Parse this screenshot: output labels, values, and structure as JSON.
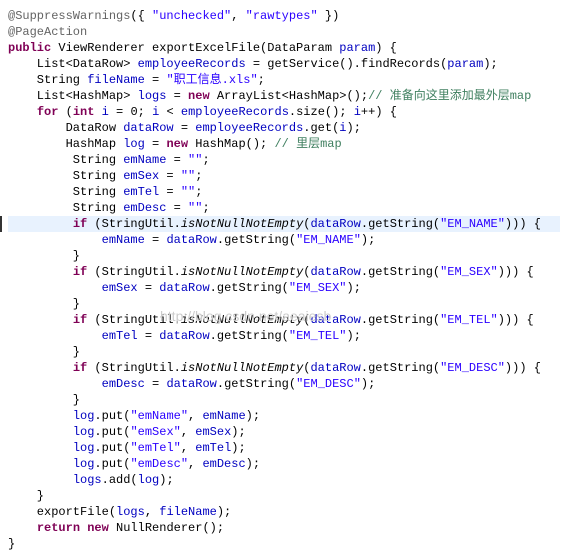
{
  "code": {
    "l1": {
      "ann": "@SuppressWarnings",
      "rest": "({ ",
      "s1": "\"unchecked\"",
      "mid": ", ",
      "s2": "\"rawtypes\"",
      "end": " })"
    },
    "l2": {
      "ann": "@PageAction"
    },
    "l3": {
      "kw": "public",
      "a": " ViewRenderer exportExcelFile(DataParam ",
      "p": "param",
      "b": ") {"
    },
    "l4": {
      "a": "    List<DataRow> ",
      "v": "employeeRecords",
      "b": " = getService().findRecords(",
      "p": "param",
      "c": ");"
    },
    "l5": {
      "a": "    String ",
      "v": "fileName",
      "b": " = ",
      "s": "\"职工信息.xls\"",
      "c": ";"
    },
    "l6": {
      "a": "    List<HashMap> ",
      "v": "logs",
      "b": " = ",
      "kw": "new",
      "c": " ArrayList<HashMap>();",
      "cmt": "// 准备向这里添加最外层map"
    },
    "l7": "",
    "l8": {
      "i": "    ",
      "kw1": "for",
      "a": " (",
      "kw2": "int",
      "b": " ",
      "v": "i",
      "c": " = 0; ",
      "v2": "i",
      "d": " < ",
      "v3": "employeeRecords",
      "e": ".size(); ",
      "v4": "i",
      "f": "++) {"
    },
    "l9": {
      "a": "        DataRow ",
      "v": "dataRow",
      "b": " = ",
      "v2": "employeeRecords",
      "c": ".get(",
      "v3": "i",
      "d": ");"
    },
    "l10": {
      "a": "        HashMap ",
      "v": "log",
      "b": " = ",
      "kw": "new",
      "c": " HashMap(); ",
      "cmt": "// 里层map"
    },
    "l11": {
      "a": "         String ",
      "v": "emName",
      "b": " = ",
      "s": "\"\"",
      "c": ";"
    },
    "l12": {
      "a": "         String ",
      "v": "emSex",
      "b": " = ",
      "s": "\"\"",
      "c": ";"
    },
    "l13": {
      "a": "         String ",
      "v": "emTel",
      "b": " = ",
      "s": "\"\"",
      "c": ";"
    },
    "l14": {
      "a": "         String ",
      "v": "emDesc",
      "b": " = ",
      "s": "\"\"",
      "c": ";"
    },
    "l15": {
      "i": "         ",
      "kw": "if",
      "a": " (StringUtil.",
      "m": "isNotNullNotEmpty",
      "b": "(",
      "v": "dataRow",
      "c": ".getString(",
      "s": "\"EM_NAME\"",
      "d": "))) {"
    },
    "l16": {
      "a": "             ",
      "v": "emName",
      "b": " = ",
      "v2": "dataRow",
      "c": ".getString(",
      "s": "\"EM_NAME\"",
      "d": ");"
    },
    "l17": "         }",
    "l18": {
      "i": "         ",
      "kw": "if",
      "a": " (StringUtil.",
      "m": "isNotNullNotEmpty",
      "b": "(",
      "v": "dataRow",
      "c": ".getString(",
      "s": "\"EM_SEX\"",
      "d": "))) {"
    },
    "l19": {
      "a": "             ",
      "v": "emSex",
      "b": " = ",
      "v2": "dataRow",
      "c": ".getString(",
      "s": "\"EM_SEX\"",
      "d": ");"
    },
    "l20": "         }",
    "l21": {
      "i": "         ",
      "kw": "if",
      "a": " (StringUtil.",
      "m": "isNotNullNotEmpty",
      "b": "(",
      "v": "dataRow",
      "c": ".getString(",
      "s": "\"EM_TEL\"",
      "d": "))) {"
    },
    "l22": {
      "a": "             ",
      "v": "emTel",
      "b": " = ",
      "v2": "dataRow",
      "c": ".getString(",
      "s": "\"EM_TEL\"",
      "d": ");"
    },
    "l23": "         }",
    "l24": {
      "i": "         ",
      "kw": "if",
      "a": " (StringUtil.",
      "m": "isNotNullNotEmpty",
      "b": "(",
      "v": "dataRow",
      "c": ".getString(",
      "s": "\"EM_DESC\"",
      "d": "))) {"
    },
    "l25": {
      "a": "             ",
      "v": "emDesc",
      "b": " = ",
      "v2": "dataRow",
      "c": ".getString(",
      "s": "\"EM_DESC\"",
      "d": ");"
    },
    "l26": "         }",
    "l27": {
      "a": "         ",
      "v": "log",
      "b": ".put(",
      "s": "\"emName\"",
      "c": ", ",
      "v2": "emName",
      "d": ");"
    },
    "l28": {
      "a": "         ",
      "v": "log",
      "b": ".put(",
      "s": "\"emSex\"",
      "c": ", ",
      "v2": "emSex",
      "d": ");"
    },
    "l29": {
      "a": "         ",
      "v": "log",
      "b": ".put(",
      "s": "\"emTel\"",
      "c": ", ",
      "v2": "emTel",
      "d": ");"
    },
    "l30": {
      "a": "         ",
      "v": "log",
      "b": ".put(",
      "s": "\"emDesc\"",
      "c": ", ",
      "v2": "emDesc",
      "d": ");"
    },
    "l31": {
      "a": "         ",
      "v": "logs",
      "b": ".add(",
      "v2": "log",
      "c": ");"
    },
    "l32": "    }",
    "l33": "",
    "l34": {
      "a": "    exportFile(",
      "v": "logs",
      "b": ", ",
      "v2": "fileName",
      "c": ");"
    },
    "l35": {
      "i": "    ",
      "kw": "return new",
      "a": " NullRenderer();"
    },
    "l36": "}"
  },
  "watermark": "http://blog.csdn.net/aeaiesb"
}
